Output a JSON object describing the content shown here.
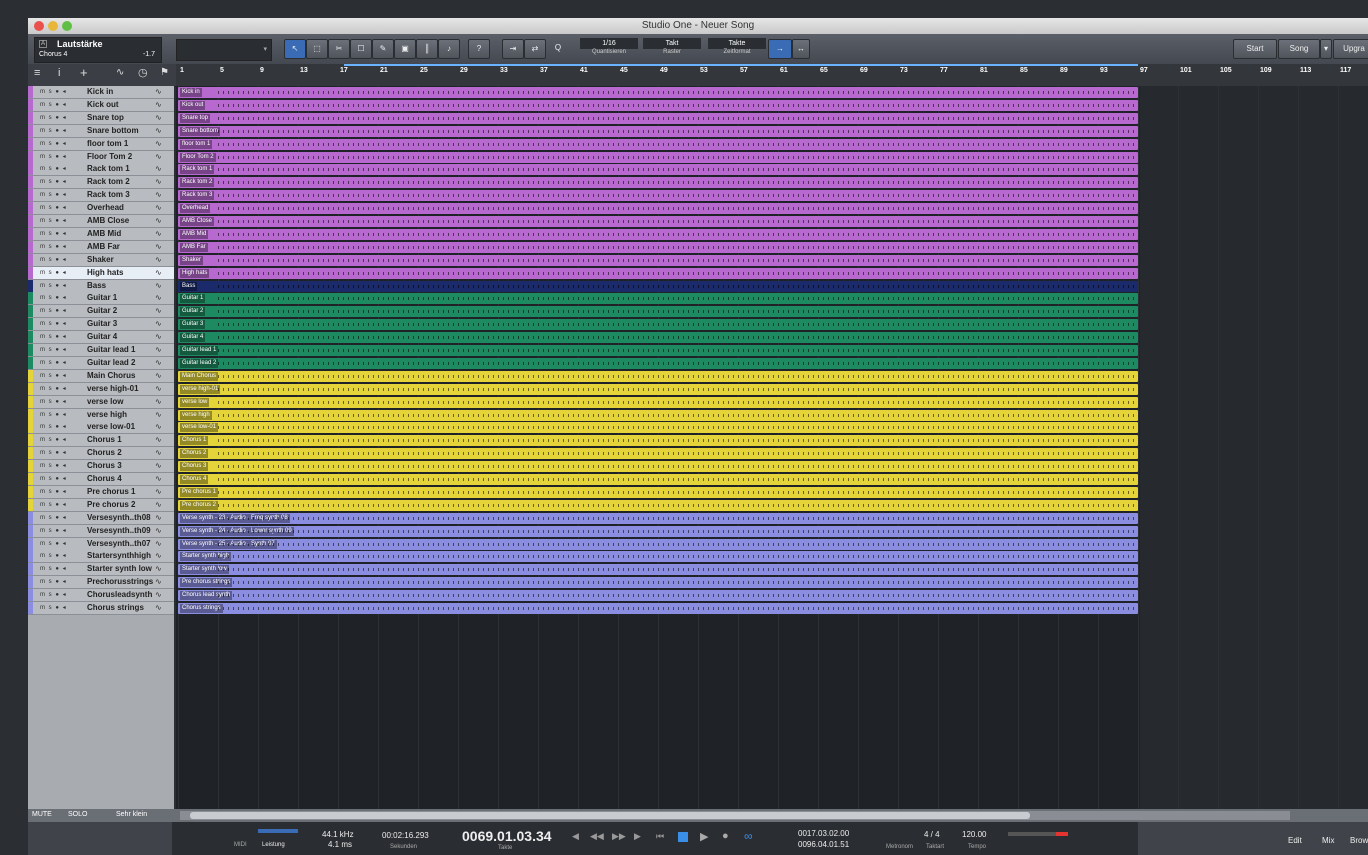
{
  "window": {
    "title": "Studio One - Neuer Song"
  },
  "colors": {
    "purple": "#b769cf",
    "green": "#1e8a62",
    "yellow": "#e4d43a",
    "blue": "#8a8de0",
    "navy": "#1a2a6a",
    "accent": "#3a6cb5"
  },
  "inspector": {
    "param": "Lautstärke",
    "track": "Chorus 4",
    "value": "-1.7"
  },
  "toolbar": {
    "quantize": "1/16",
    "quantize_label": "Quantisieren",
    "snap": "Takt",
    "snap_label": "Raster",
    "timeformat": "Takte",
    "timeformat_label": "Zeitformat",
    "start": "Start",
    "song": "Song",
    "upgrade": "Upgra"
  },
  "ruler": [
    "1",
    "5",
    "9",
    "13",
    "17",
    "21",
    "25",
    "29",
    "33",
    "37",
    "41",
    "45",
    "49",
    "53",
    "57",
    "61",
    "65",
    "69",
    "73",
    "77",
    "81",
    "85",
    "89",
    "93",
    "97",
    "101",
    "105",
    "109",
    "113",
    "117"
  ],
  "tracks": [
    {
      "name": "Kick in",
      "clip": "Kick in",
      "c": "purple"
    },
    {
      "name": "Kick out",
      "clip": "Kick out",
      "c": "purple"
    },
    {
      "name": "Snare top",
      "clip": "Snare top",
      "c": "purple"
    },
    {
      "name": "Snare bottom",
      "clip": "Snare bottom",
      "c": "purple"
    },
    {
      "name": "floor tom 1",
      "clip": "floor tom 1",
      "c": "purple"
    },
    {
      "name": "Floor Tom 2",
      "clip": "Floor Tom 2",
      "c": "purple"
    },
    {
      "name": "Rack tom 1",
      "clip": "Rack tom 1",
      "c": "purple"
    },
    {
      "name": "Rack tom 2",
      "clip": "Rack tom 2",
      "c": "purple"
    },
    {
      "name": "Rack tom 3",
      "clip": "Rack tom 3",
      "c": "purple"
    },
    {
      "name": "Overhead",
      "clip": "Overhead",
      "c": "purple"
    },
    {
      "name": "AMB Close",
      "clip": "AMB Close",
      "c": "purple"
    },
    {
      "name": "AMB Mid",
      "clip": "AMB Mid",
      "c": "purple"
    },
    {
      "name": "AMB Far",
      "clip": "AMB Far",
      "c": "purple"
    },
    {
      "name": "Shaker",
      "clip": "Shaker",
      "c": "purple"
    },
    {
      "name": "High hats",
      "clip": "High hats",
      "c": "purple"
    },
    {
      "name": "Bass",
      "clip": "Bass",
      "c": "navy"
    },
    {
      "name": "Guitar 1",
      "clip": "Guitar 1",
      "c": "green"
    },
    {
      "name": "Guitar 2",
      "clip": "Guitar 2",
      "c": "green"
    },
    {
      "name": "Guitar 3",
      "clip": "Guitar 3",
      "c": "green"
    },
    {
      "name": "Guitar 4",
      "clip": "Guitar 4",
      "c": "green"
    },
    {
      "name": "Guitar lead 1",
      "clip": "Guitar lead 1",
      "c": "green"
    },
    {
      "name": "Guitar lead 2",
      "clip": "Guitar lead 2",
      "c": "green"
    },
    {
      "name": "Main Chorus",
      "clip": "Main Chorus",
      "c": "yellow"
    },
    {
      "name": "verse high-01",
      "clip": "verse high-01",
      "c": "yellow"
    },
    {
      "name": "verse low",
      "clip": "verse low",
      "c": "yellow"
    },
    {
      "name": "verse high",
      "clip": "verse high",
      "c": "yellow"
    },
    {
      "name": "verse low-01",
      "clip": "verse low-01",
      "c": "yellow"
    },
    {
      "name": "Chorus 1",
      "clip": "Chorus 1",
      "c": "yellow"
    },
    {
      "name": "Chorus 2",
      "clip": "Chorus 2",
      "c": "yellow"
    },
    {
      "name": "Chorus 3",
      "clip": "Chorus 3",
      "c": "yellow"
    },
    {
      "name": "Chorus 4",
      "clip": "Chorus 4",
      "c": "yellow"
    },
    {
      "name": "Pre chorus 1",
      "clip": "Pre chorus 1",
      "c": "yellow"
    },
    {
      "name": "Pre chorus 2",
      "clip": "Pre chorus 2",
      "c": "yellow"
    },
    {
      "name": "Versesynth..th08",
      "clip": "Verse synth - 23 - Audio - Freq synth 08",
      "c": "blue"
    },
    {
      "name": "Versesynth..th09",
      "clip": "Verse synth - 24 - Audio - Lower synth 09",
      "c": "blue"
    },
    {
      "name": "Versesynth..th07",
      "clip": "Verse synth - 25 - Audio - Synth 07",
      "c": "blue"
    },
    {
      "name": "Startersynthhigh",
      "clip": "Starter synth high",
      "c": "blue"
    },
    {
      "name": "Starter synth low",
      "clip": "Starter synth low",
      "c": "blue"
    },
    {
      "name": "Prechorusstrings",
      "clip": "Pre chorus strings",
      "c": "blue"
    },
    {
      "name": "Chorusleadsynth",
      "clip": "Chorus lead synth",
      "c": "blue"
    },
    {
      "name": "Chorus strings",
      "clip": "Chorus strings",
      "c": "blue"
    }
  ],
  "selected_track": "High hats",
  "footer": {
    "mute": "MUTE",
    "solo": "SOLO",
    "size": "Sehr klein"
  },
  "transport": {
    "midi": "MIDI",
    "leistung": "Leistung",
    "rate": "44.1 kHz",
    "latency": "4.1 ms",
    "seconds": "00:02:16.293",
    "seconds_label": "Sekunden",
    "position": "0069.01.03.34",
    "position_label": "Takte",
    "loop_start": "0017.03.02.00",
    "loop_end": "0096.04.01.51",
    "metronome": "Metronom",
    "signature": "4 / 4",
    "signature_label": "Taktart",
    "tempo": "120.00",
    "tempo_label": "Tempo",
    "edit": "Edit",
    "mix": "Mix",
    "browse": "Brow"
  }
}
